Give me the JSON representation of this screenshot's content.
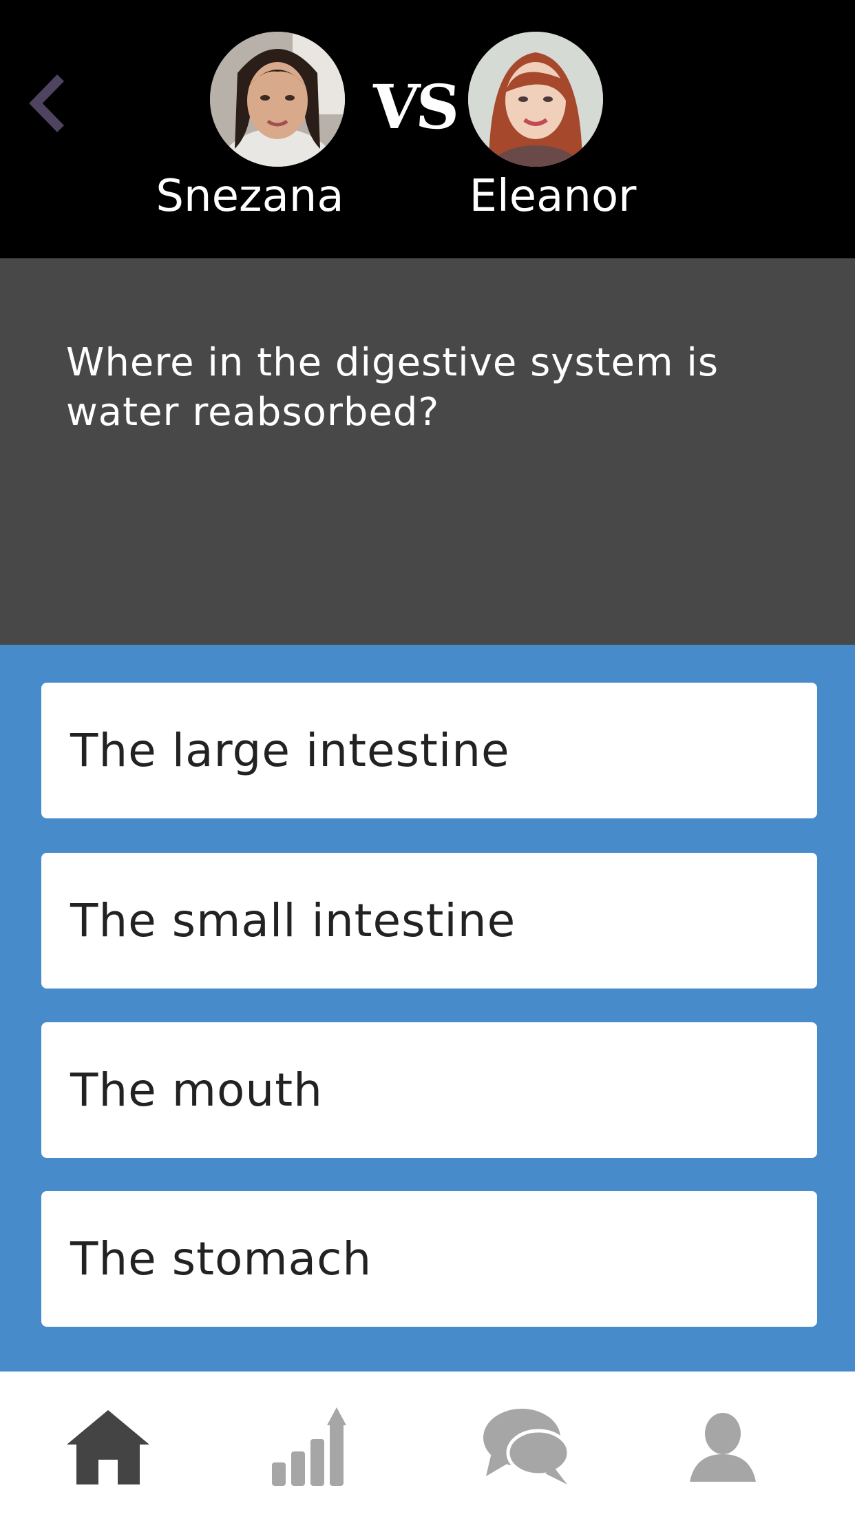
{
  "header": {
    "back_icon": "chevron-left-icon",
    "vs_label": "VS",
    "player1": {
      "name": "Snezana"
    },
    "player2": {
      "name": "Eleanor"
    }
  },
  "question": {
    "text": "Where in the digestive system is water reabsorbed?"
  },
  "answers": [
    {
      "label": "The large intestine"
    },
    {
      "label": "The small intestine"
    },
    {
      "label": "The mouth"
    },
    {
      "label": "The stomach"
    }
  ],
  "bottom_nav": {
    "items": [
      {
        "icon": "home-icon",
        "active": true
      },
      {
        "icon": "stats-icon",
        "active": false
      },
      {
        "icon": "chat-icon",
        "active": false
      },
      {
        "icon": "profile-icon",
        "active": false
      }
    ]
  },
  "colors": {
    "header_bg": "#000000",
    "question_bg": "#484848",
    "answers_bg": "#478bcb",
    "back_accent": "#4e4460",
    "nav_active": "#444444",
    "nav_inactive": "#a6a6a6"
  }
}
